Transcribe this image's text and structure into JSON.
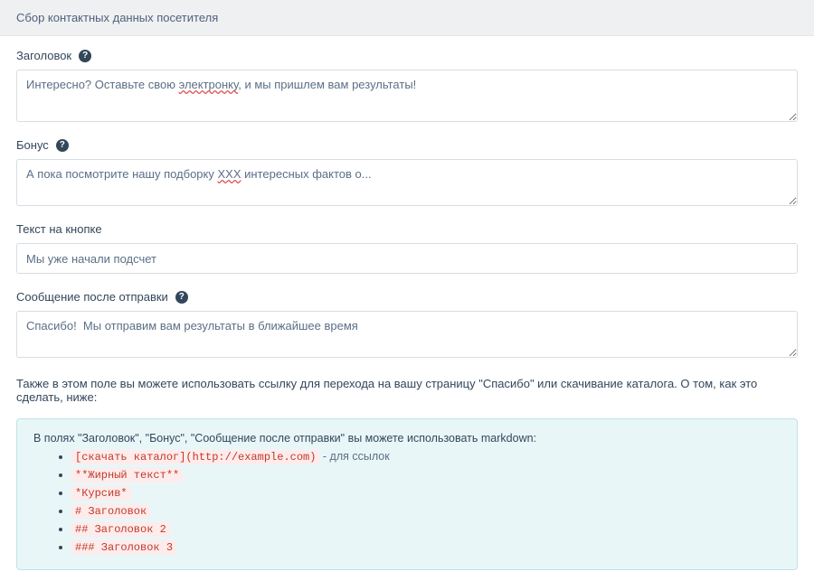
{
  "panel": {
    "title": "Сбор контактных данных посетителя"
  },
  "fields": {
    "heading": {
      "label": "Заголовок",
      "value_pre": "Интересно? Оставьте свою ",
      "value_spell": "электронку",
      "value_post": ", и мы пришлем вам результаты!"
    },
    "bonus": {
      "label": "Бонус",
      "value_pre": "А пока посмотрите нашу подборку ",
      "value_spell": "XXX",
      "value_post": " интересных фактов о..."
    },
    "button_text": {
      "label": "Текст на кнопке",
      "value": "Мы уже начали подсчет"
    },
    "after_submit": {
      "label": "Сообщение после отправки",
      "value": "Спасибо!  Мы отправим вам результаты в ближайшее время"
    }
  },
  "note": "Также в этом поле вы можете использовать ссылку для перехода на вашу страницу \"Спасибо\" или скачивание каталога. О том, как это сделать, ниже:",
  "infobox": {
    "intro": "В полях \"Заголовок\", \"Бонус\", \"Сообщение после отправки\" вы можете использовать markdown:",
    "items": [
      {
        "code": "[скачать каталог](http://example.com)",
        "suffix": "  - для ссылок"
      },
      {
        "code": "**Жирный текст**",
        "suffix": ""
      },
      {
        "code": "*Курсив*",
        "suffix": ""
      },
      {
        "code": "# Заголовок",
        "suffix": ""
      },
      {
        "code": "## Заголовок 2",
        "suffix": ""
      },
      {
        "code": "### Заголовок 3",
        "suffix": ""
      }
    ]
  }
}
